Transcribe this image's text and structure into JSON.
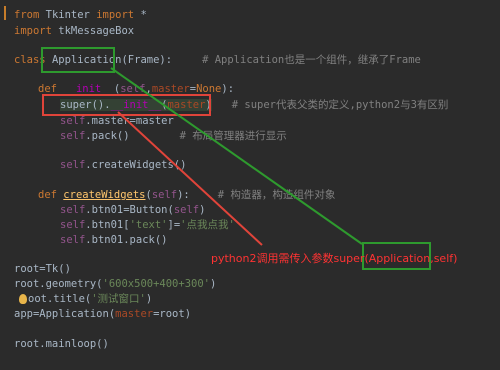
{
  "code": {
    "l1": {
      "kw": "from",
      "mod": " Tkinter ",
      "kw2": "import",
      "rest": " *"
    },
    "l2": {
      "kw": "import",
      "rest": " tkMessageBox"
    },
    "l3": {
      "kw": "class ",
      "name": "Application",
      "rest": "(Frame):",
      "comment": "# Application也是一个组件，继承了Frame"
    },
    "l4": {
      "kw": "def ",
      "name": "__init__",
      "p1": "(",
      "self": "self",
      "p2": ",",
      "param": "master",
      "p3": "=",
      "none": "None",
      "p4": "):"
    },
    "l5": {
      "fn": "super",
      "p1": "().",
      "name": "__init__",
      "p2": "(",
      "param": "master",
      "p3": ")",
      "comment": "# super代表父类的定义,python2与3有区别"
    },
    "l6": {
      "self": "self",
      "rest": ".master=master"
    },
    "l7": {
      "self": "self",
      "rest": ".pack()",
      "comment": "# 布局管理器进行显示"
    },
    "l8": {
      "self": "self",
      "rest": ".createWidgets()"
    },
    "l9": {
      "kw": "def ",
      "name": "createWidgets",
      "p1": "(",
      "self": "self",
      "p2": "):",
      "comment": "# 构造器，构造组件对象"
    },
    "l10": {
      "self": "self",
      "rest": ".btn01=Button(",
      "self2": "self",
      "p": ")"
    },
    "l11": {
      "self": "self",
      "rest": ".btn01[",
      "str": "'text'",
      "eq": "]=",
      "str2": "'点我点我'"
    },
    "l12": {
      "self": "self",
      "rest": ".btn01.pack()"
    },
    "l13": {
      "rest": "root=Tk()"
    },
    "l14": {
      "rest": "root.geometry(",
      "str": "'600x500+400+300'",
      "p": ")"
    },
    "l15": {
      "rest": "oot.title(",
      "str": "'测试窗口'",
      "p": ")"
    },
    "l16": {
      "rest": "app=Application(",
      "param": "master",
      "eq": "=root)"
    },
    "l17": {
      "rest": "root.mainloop()"
    }
  },
  "annotation": "python2调用需传入参数super(Application,self)",
  "colors": {
    "green": "#2e9a2e",
    "red": "#e0443a",
    "annotation": "#ff3333"
  }
}
